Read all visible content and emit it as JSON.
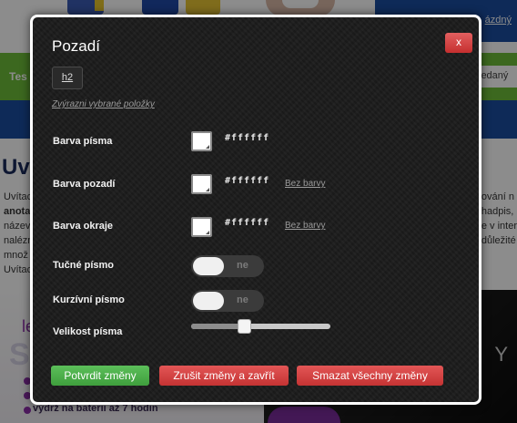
{
  "background": {
    "login_link": "ázdný",
    "green_bar_text": "Tes",
    "search_text": "ledaný",
    "page_title": "Uv",
    "left_lines": [
      "Uvítac",
      "anotac",
      "název",
      "nalézn",
      "množ",
      "Uvítac"
    ],
    "right_lines": [
      "ování n",
      "hadpis,",
      "e v inter",
      "důležité"
    ],
    "banner_big_letter": "S",
    "banner_le": "le",
    "banner_right_glyph": "Y",
    "banner_battery_text": "výdrž na baterii až 7 hodin"
  },
  "dialog": {
    "title": "Pozadí",
    "close_label": "x",
    "tag_button": "h2",
    "highlight_link": "Zvýrazni vybrané položky",
    "rows": {
      "font_color": {
        "label": "Barva písma",
        "hex": "#ffffff"
      },
      "bg_color": {
        "label": "Barva pozadí",
        "hex": "#ffffff",
        "no_color": "Bez barvy"
      },
      "border_color": {
        "label": "Barva okraje",
        "hex": "#ffffff",
        "no_color": "Bez barvy"
      },
      "bold": {
        "label": "Tučné písmo",
        "state": "ne"
      },
      "italic": {
        "label": "Kurzívní písmo",
        "state": "ne"
      },
      "font_size": {
        "label": "Velikost písma",
        "level": 0.37
      }
    },
    "buttons": {
      "confirm": "Potvrdit změny",
      "cancel": "Zrušit změny a zavřít",
      "clear": "Smazat všechny změny"
    }
  },
  "colors": {
    "confirm": "#4caf4a",
    "danger": "#d43f3f",
    "dialog_bg": "#1b1b1b",
    "green_bar": "#6ebe3a",
    "blue_bar": "#1a4ea0"
  }
}
